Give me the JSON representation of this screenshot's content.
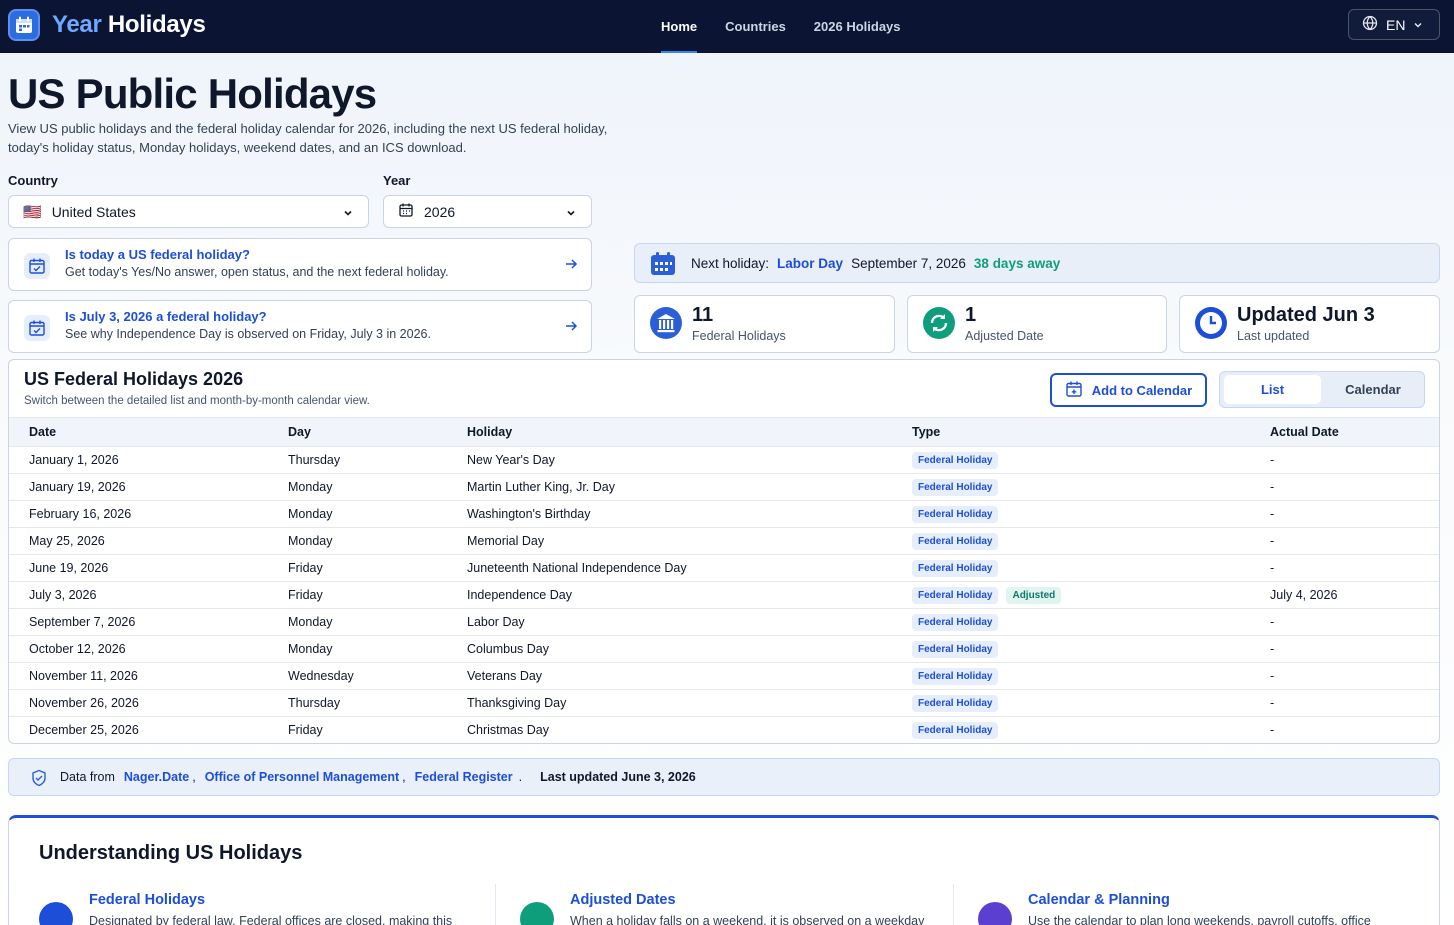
{
  "nav": {
    "brand_accent": "Year",
    "brand_rest": " Holidays",
    "links": [
      "Home",
      "Countries",
      "2026 Holidays"
    ],
    "lang": "EN"
  },
  "hero": {
    "title": "US Public Holidays",
    "description": "View US public holidays and the federal holiday calendar for 2026, including the next US federal holiday, today's holiday status, Monday holidays, weekend dates, and an ICS download."
  },
  "filters": {
    "country_label": "Country",
    "country_flag": "🇺🇸",
    "country_value": "United States",
    "year_label": "Year",
    "year_value": "2026"
  },
  "questions": [
    {
      "title": "Is today a US federal holiday?",
      "subtitle": "Get today's Yes/No answer, open status, and the next federal holiday."
    },
    {
      "title": "Is July 3, 2026 a federal holiday?",
      "subtitle": "See why Independence Day is observed on Friday, July 3 in 2026."
    }
  ],
  "next_holiday": {
    "label": "Next holiday:",
    "name": "Labor Day",
    "date": "September 7, 2026",
    "countdown": "38 days away"
  },
  "stats": [
    {
      "value": "11",
      "label": "Federal Holidays"
    },
    {
      "value": "1",
      "label": "Adjusted Date"
    },
    {
      "value": "Updated Jun 3",
      "label": "Last updated"
    }
  ],
  "table": {
    "title": "US Federal Holidays 2026",
    "subtitle": "Switch between the detailed list and month-by-month calendar view.",
    "add_to_calendar": "Add to Calendar",
    "view_list": "List",
    "view_calendar": "Calendar",
    "headers": [
      "Date",
      "Day",
      "Holiday",
      "Type",
      "Actual Date"
    ],
    "rows": [
      {
        "date": "January 1, 2026",
        "day": "Thursday",
        "holiday": "New Year's Day",
        "type": "Federal Holiday",
        "adjusted": "",
        "actual": "-"
      },
      {
        "date": "January 19, 2026",
        "day": "Monday",
        "holiday": "Martin Luther King, Jr. Day",
        "type": "Federal Holiday",
        "adjusted": "",
        "actual": "-"
      },
      {
        "date": "February 16, 2026",
        "day": "Monday",
        "holiday": "Washington's Birthday",
        "type": "Federal Holiday",
        "adjusted": "",
        "actual": "-"
      },
      {
        "date": "May 25, 2026",
        "day": "Monday",
        "holiday": "Memorial Day",
        "type": "Federal Holiday",
        "adjusted": "",
        "actual": "-"
      },
      {
        "date": "June 19, 2026",
        "day": "Friday",
        "holiday": "Juneteenth National Independence Day",
        "type": "Federal Holiday",
        "adjusted": "",
        "actual": "-"
      },
      {
        "date": "July 3, 2026",
        "day": "Friday",
        "holiday": "Independence Day",
        "type": "Federal Holiday",
        "adjusted": "Adjusted",
        "actual": "July 4, 2026"
      },
      {
        "date": "September 7, 2026",
        "day": "Monday",
        "holiday": "Labor Day",
        "type": "Federal Holiday",
        "adjusted": "",
        "actual": "-"
      },
      {
        "date": "October 12, 2026",
        "day": "Monday",
        "holiday": "Columbus Day",
        "type": "Federal Holiday",
        "adjusted": "",
        "actual": "-"
      },
      {
        "date": "November 11, 2026",
        "day": "Wednesday",
        "holiday": "Veterans Day",
        "type": "Federal Holiday",
        "adjusted": "",
        "actual": "-"
      },
      {
        "date": "November 26, 2026",
        "day": "Thursday",
        "holiday": "Thanksgiving Day",
        "type": "Federal Holiday",
        "adjusted": "",
        "actual": "-"
      },
      {
        "date": "December 25, 2026",
        "day": "Friday",
        "holiday": "Christmas Day",
        "type": "Federal Holiday",
        "adjusted": "",
        "actual": "-"
      }
    ]
  },
  "sources": {
    "prefix": "Data from",
    "links": [
      "Nager.Date",
      "Office of Personnel Management",
      "Federal Register"
    ],
    "updated": "Last updated June 3, 2026"
  },
  "understanding": {
    "title": "Understanding US Holidays",
    "columns": [
      {
        "title": "Federal Holidays",
        "text": "Designated by federal law. Federal offices are closed, making this"
      },
      {
        "title": "Adjusted Dates",
        "text": "When a holiday falls on a weekend, it is observed on a weekday"
      },
      {
        "title": "Calendar & Planning",
        "text": "Use the calendar to plan long weekends, payroll cutoffs, office"
      }
    ]
  },
  "colors": {
    "nav_bg": "#0b1533",
    "accent": "#1d4ed8",
    "adjusted": "#0f766e",
    "countdown": "#0f9e7b"
  },
  "icons": [
    "calendar-logo-icon",
    "globe-icon",
    "chevron-down-icon",
    "calendar-icon",
    "calendar-check-icon",
    "arrow-right-icon",
    "building-icon",
    "refresh-icon",
    "clock-icon",
    "calendar-plus-icon",
    "shield-check-icon"
  ]
}
